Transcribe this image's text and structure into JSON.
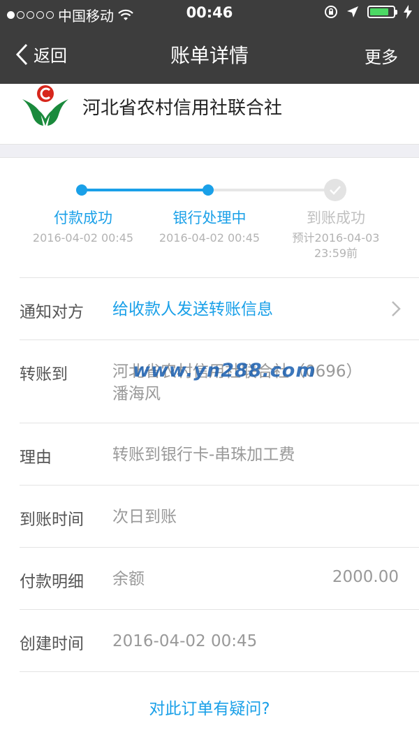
{
  "status_bar": {
    "carrier": "中国移动",
    "time": "00:46",
    "battery_level": 0.8,
    "battery_color": "#4cd964"
  },
  "nav": {
    "back_label": "返回",
    "title": "账单详情",
    "more_label": "更多"
  },
  "bank": {
    "name": "河北省农村信用社联合社",
    "logo_icon": "rural-credit-union-logo"
  },
  "progress": {
    "steps": [
      {
        "label": "付款成功",
        "time": "2016-04-02 00:45",
        "state": "done"
      },
      {
        "label": "银行处理中",
        "time": "2016-04-02 00:45",
        "state": "current"
      },
      {
        "label": "到账成功",
        "time_line1": "预计2016-04-03",
        "time_line2": "23:59前",
        "state": "pending"
      }
    ],
    "accent_color": "#1aa0e8"
  },
  "details": {
    "notify": {
      "label": "通知对方",
      "value": "给收款人发送转账信息"
    },
    "transfer_to": {
      "label": "转账到",
      "value_line1": "河北省农村信用社联合社（0696）",
      "value_line2": "潘海风"
    },
    "reason": {
      "label": "理由",
      "value": "转账到银行卡-串珠加工费"
    },
    "arrival": {
      "label": "到账时间",
      "value": "次日到账"
    },
    "payment": {
      "label": "付款明细",
      "value": "余额",
      "amount": "2000.00"
    },
    "created": {
      "label": "创建时间",
      "value": "2016-04-02 00:45"
    }
  },
  "watermark": "www.yn288.com",
  "question_link": "对此订单有疑问?"
}
